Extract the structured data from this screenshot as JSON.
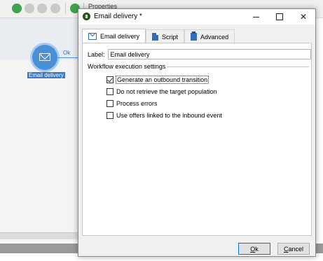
{
  "background": {
    "toolbar_label": "Properties",
    "node_label": "Email delivery",
    "transition_label": "Ok"
  },
  "dialog": {
    "title": "Email delivery *",
    "tabs": [
      {
        "label": "Email delivery",
        "icon": "email-icon"
      },
      {
        "label": "Script",
        "icon": "script-icon"
      },
      {
        "label": "Advanced",
        "icon": "clipboard-icon"
      }
    ],
    "label_field": {
      "caption": "Label:",
      "value": "Email delivery"
    },
    "group_title": "Workflow execution settings",
    "options": [
      {
        "label": "Generate an outbound transition",
        "checked": true
      },
      {
        "label": "Do not retrieve the target population",
        "checked": false
      },
      {
        "label": "Process errors",
        "checked": false
      },
      {
        "label": "Use offers linked to the inbound event",
        "checked": false
      }
    ],
    "ok_button": {
      "first": "O",
      "rest": "k"
    },
    "cancel_button": {
      "first": "C",
      "rest": "ancel"
    }
  }
}
